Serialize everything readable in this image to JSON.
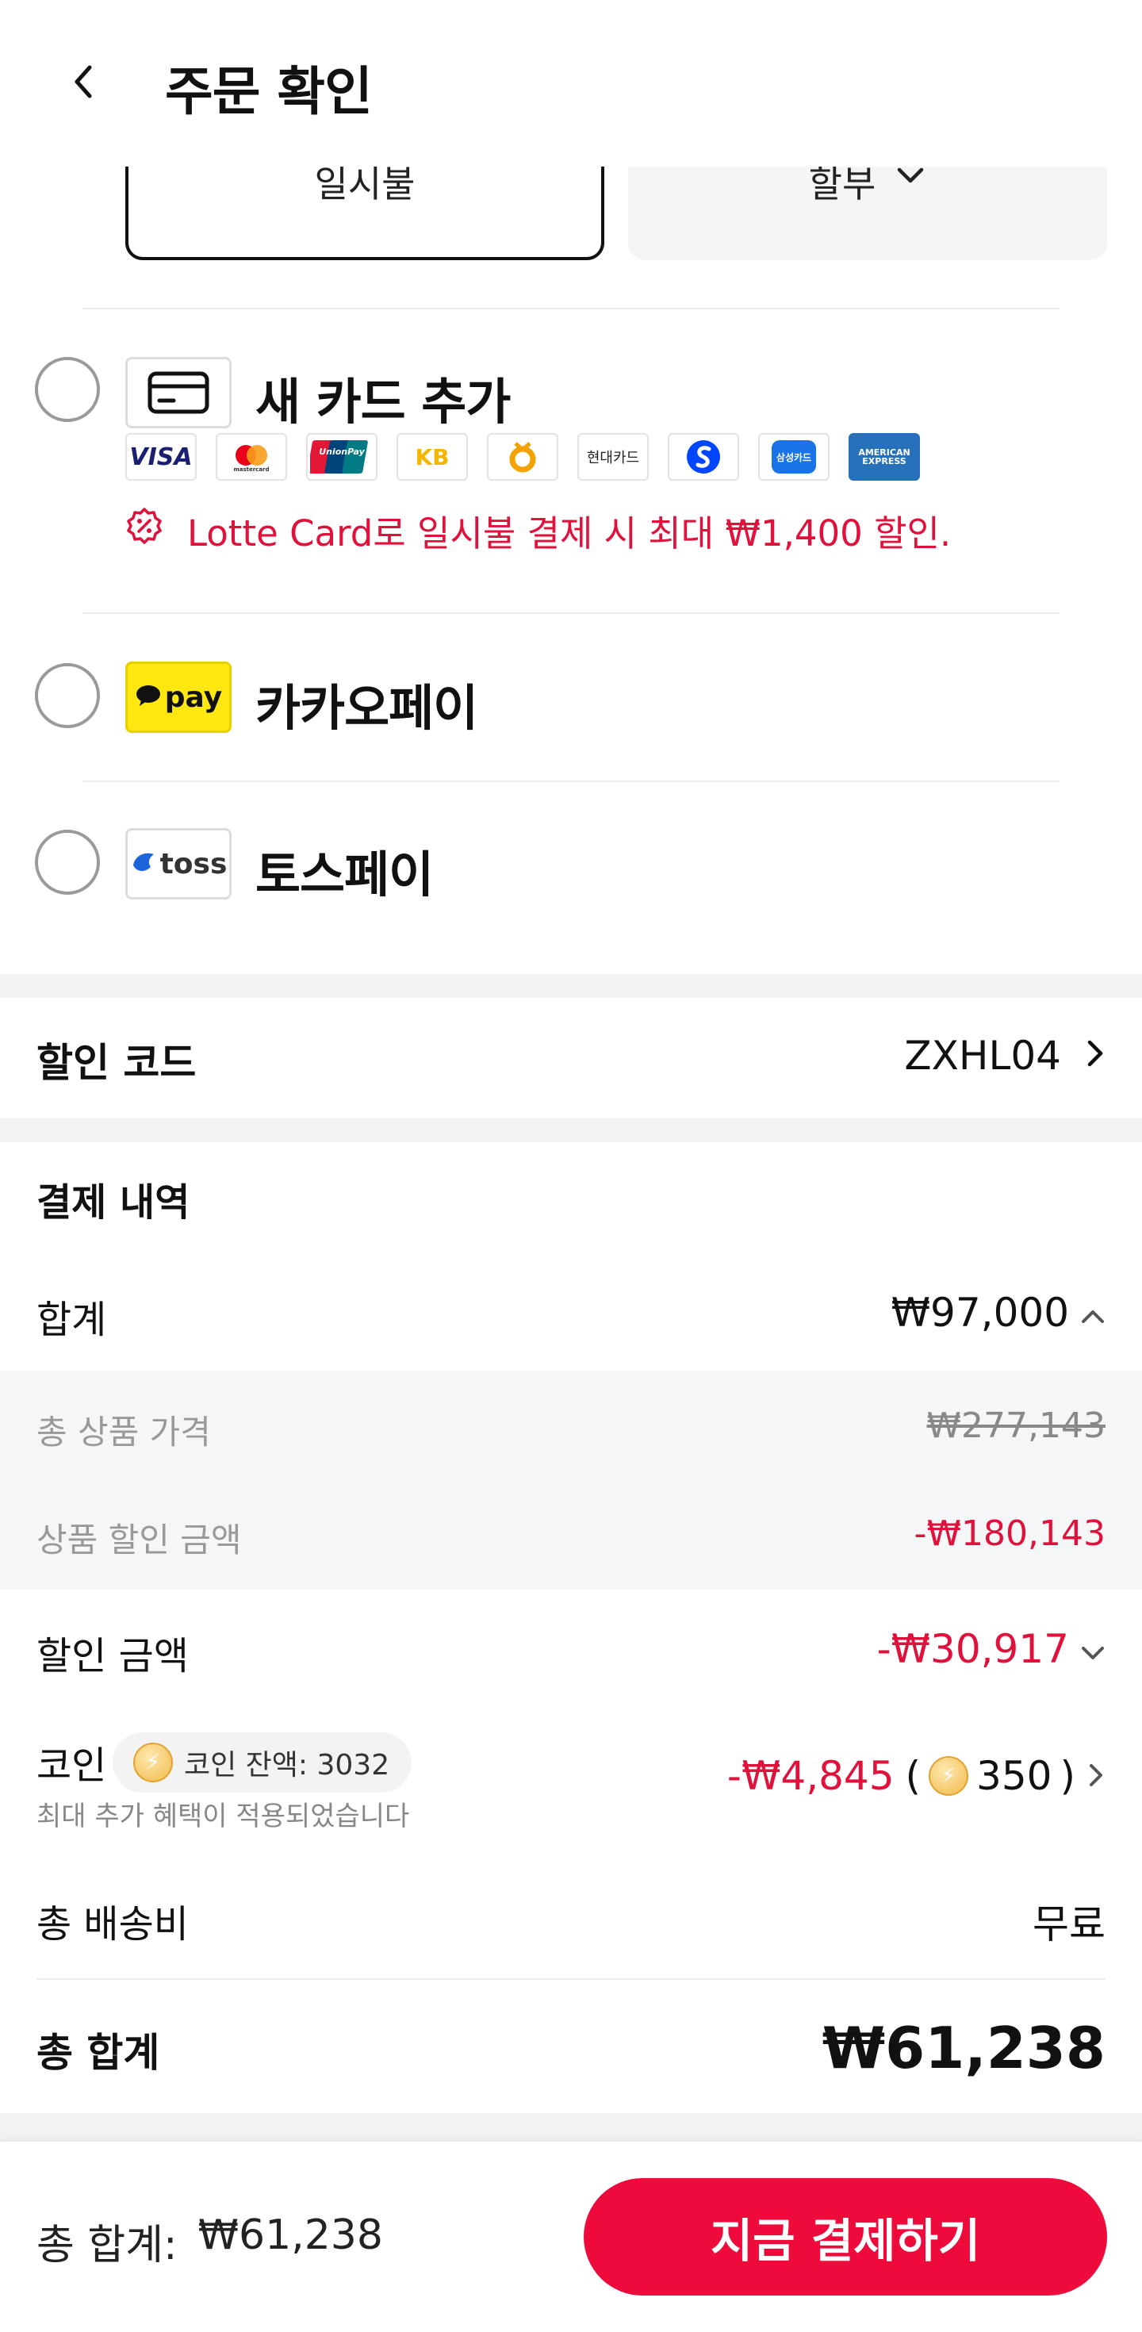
{
  "header": {
    "title": "주문 확인",
    "back_icon": "chevron-left-icon"
  },
  "installment": {
    "option_a": "일시불",
    "option_b": "할부"
  },
  "payment_methods": {
    "new_card": {
      "label": "새 카드 추가",
      "brands": [
        "VISA",
        "mastercard",
        "UnionPay",
        "KB",
        "NH",
        "현대카드",
        "Shinhan",
        "삼성카드",
        "AMERICAN EXPRESS"
      ],
      "promo": "Lotte Card로 일시불 결제 시 최대 ₩1,400 할인."
    },
    "kakaopay": {
      "label": "카카오페이",
      "logo_text": "pay"
    },
    "tosspay": {
      "label": "토스페이",
      "logo_text": "toss"
    }
  },
  "discount_code": {
    "label": "할인 코드",
    "value": "ZXHL04"
  },
  "payment_details": {
    "title": "결제 내역",
    "subtotal": {
      "label": "합계",
      "value": "₩97,000"
    },
    "total_product_price": {
      "label": "총 상품 가격",
      "value": "₩277,143"
    },
    "product_discount": {
      "label": "상품 할인 금액",
      "value": "-₩180,143"
    },
    "discount_amount": {
      "label": "할인 금액",
      "value": "-₩30,917"
    },
    "coin": {
      "label": "코인",
      "balance": "코인 잔액: 3032",
      "note": "최대 추가 혜택이 적용되었습니다",
      "value": "-₩4,845",
      "coins_used": "350"
    },
    "shipping": {
      "label": "총 배송비",
      "value": "무료"
    },
    "grand_total": {
      "label": "총 합계",
      "value": "₩61,238"
    }
  },
  "bottom_bar": {
    "total_label": "총 합계:",
    "total_value": "₩61,238",
    "pay_button": "지금 결제하기"
  },
  "colors": {
    "accent": "#ee0a3b",
    "discount_red": "#e0113a",
    "kakao_yellow": "#ffe812"
  }
}
